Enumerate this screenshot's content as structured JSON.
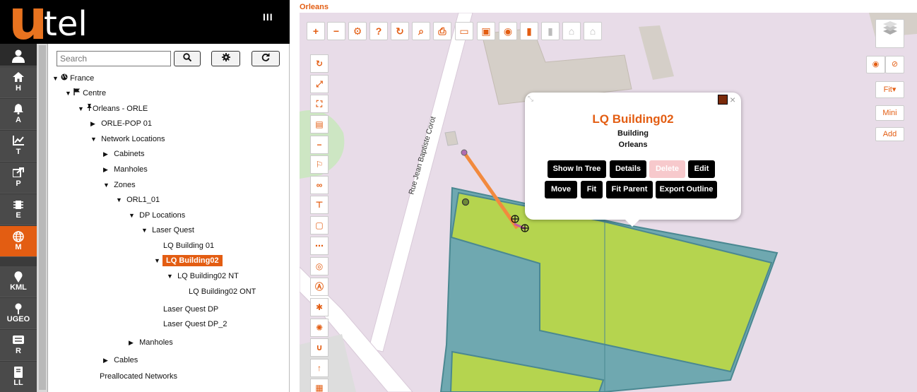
{
  "brand": {
    "logo_u": "u",
    "logo_tel": "tel",
    "menu_glyph": "III"
  },
  "nav": [
    {
      "icon": "user-icon",
      "label": ""
    },
    {
      "icon": "home-icon",
      "label": "H"
    },
    {
      "icon": "bell-icon",
      "label": "A"
    },
    {
      "icon": "chart-icon",
      "label": "T"
    },
    {
      "icon": "share-icon",
      "label": "P"
    },
    {
      "icon": "chip-icon",
      "label": "E"
    },
    {
      "icon": "globe-icon",
      "label": "M"
    },
    {
      "icon": "pin-icon",
      "label": "KML"
    },
    {
      "icon": "geo-pin-icon",
      "label": "UGEO"
    },
    {
      "icon": "report-icon",
      "label": "R"
    },
    {
      "icon": "book-icon",
      "label": "LL"
    }
  ],
  "tree": {
    "search_placeholder": "Search",
    "nodes": [
      {
        "label": "France",
        "arrow": "▼"
      },
      {
        "label": "Centre",
        "arrow": "▼"
      },
      {
        "label": "Orleans - ORLE",
        "arrow": "▼"
      },
      {
        "label": "ORLE-POP 01",
        "arrow": "▶"
      },
      {
        "label": "Network Locations",
        "arrow": "▼"
      },
      {
        "label": "Cabinets",
        "arrow": "▶"
      },
      {
        "label": "Manholes",
        "arrow": "▶"
      },
      {
        "label": "Zones",
        "arrow": "▼"
      },
      {
        "label": "ORL1_01",
        "arrow": "▼"
      },
      {
        "label": "DP Locations",
        "arrow": "▼"
      },
      {
        "label": "Laser Quest",
        "arrow": "▼"
      },
      {
        "label": "LQ Building 01",
        "arrow": ""
      },
      {
        "label": "LQ Building02",
        "arrow": "▼"
      },
      {
        "label": "LQ Building02 NT",
        "arrow": "▼"
      },
      {
        "label": "LQ Building02 ONT",
        "arrow": ""
      },
      {
        "label": "Laser Quest DP",
        "arrow": ""
      },
      {
        "label": "Laser Quest DP_2",
        "arrow": ""
      },
      {
        "label": "Manholes",
        "arrow": "▶"
      },
      {
        "label": "Cables",
        "arrow": "▶"
      },
      {
        "label": "Preallocated Networks",
        "arrow": ""
      }
    ]
  },
  "map": {
    "title": "Orleans",
    "street_label": "Rue Jean Baptiste Corot",
    "right_controls": {
      "fit": "Fit▾",
      "mini": "Mini",
      "add": "Add"
    }
  },
  "popup": {
    "title": "LQ Building02",
    "type": "Building",
    "location": "Orleans",
    "buttons_row1": [
      "Show In Tree",
      "Details",
      "Delete",
      "Edit"
    ],
    "buttons_row2": [
      "Move",
      "Fit",
      "Fit Parent",
      "Export Outline"
    ]
  },
  "colors": {
    "accent": "#e35d12",
    "building_fill": "#b5d44f",
    "zone_fill": "#6fa8b0"
  }
}
